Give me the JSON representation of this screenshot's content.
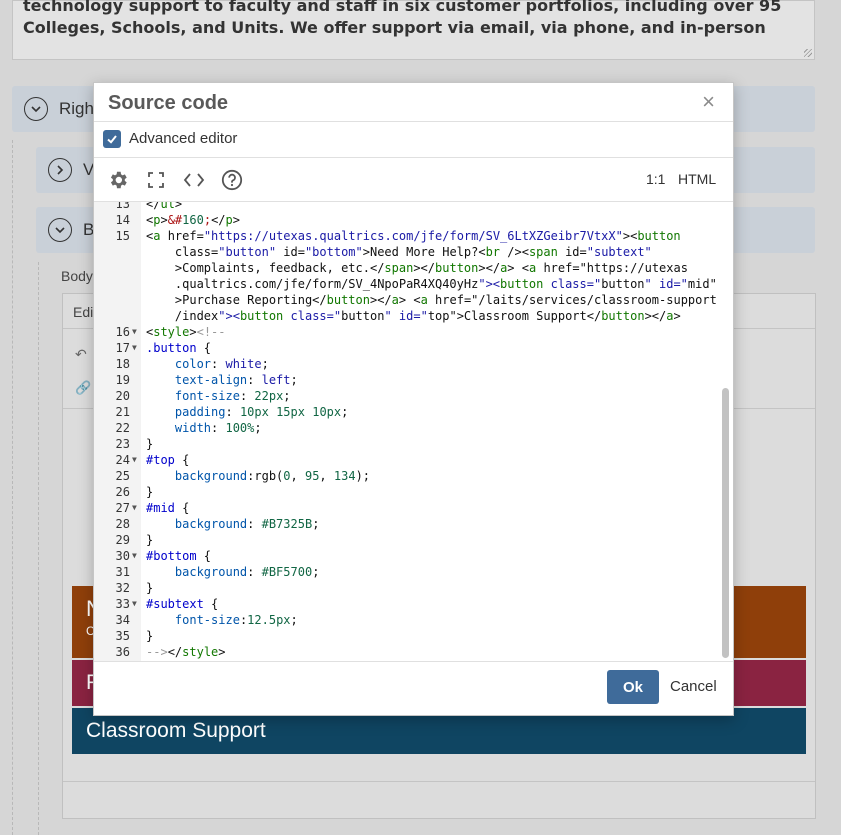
{
  "background": {
    "text_preview": "technology support to faculty and staff in six customer portfolios, including over 95",
    "text_preview2": "Colleges, Schools, and Units. We offer support via email, via phone, and in-person",
    "accordion1_label": "Righ",
    "accordion2_label": "V",
    "accordion3_label": "B",
    "body_label": "Body",
    "editor_label": "Edi",
    "strip1_letter": "N",
    "strip1_sub": "C",
    "strip2_letter": "P",
    "strip3_label": "Classroom Support",
    "colors": {
      "strip1": "#8f3f0a",
      "strip2": "#8a2341",
      "strip3": "#0f4562"
    }
  },
  "modal": {
    "title": "Source code",
    "close_glyph": "×",
    "advanced_editor_label": "Advanced editor",
    "advanced_editor_checked": true,
    "toolbar": {
      "ratio": "1:1",
      "mode": "HTML",
      "icons": [
        "gear-icon",
        "fullscreen-icon",
        "code-icon",
        "help-icon"
      ]
    },
    "code_lines": [
      {
        "n": "13",
        "fold": false
      },
      {
        "n": "14",
        "fold": false
      },
      {
        "n": "15",
        "fold": false
      },
      {
        "n": "",
        "fold": false
      },
      {
        "n": "",
        "fold": false
      },
      {
        "n": "",
        "fold": false
      },
      {
        "n": "",
        "fold": false
      },
      {
        "n": "",
        "fold": false
      },
      {
        "n": "16",
        "fold": true
      },
      {
        "n": "17",
        "fold": true
      },
      {
        "n": "18",
        "fold": false
      },
      {
        "n": "19",
        "fold": false
      },
      {
        "n": "20",
        "fold": false
      },
      {
        "n": "21",
        "fold": false
      },
      {
        "n": "22",
        "fold": false
      },
      {
        "n": "23",
        "fold": false
      },
      {
        "n": "24",
        "fold": true
      },
      {
        "n": "25",
        "fold": false
      },
      {
        "n": "26",
        "fold": false
      },
      {
        "n": "27",
        "fold": true
      },
      {
        "n": "28",
        "fold": false
      },
      {
        "n": "29",
        "fold": false
      },
      {
        "n": "30",
        "fold": true
      },
      {
        "n": "31",
        "fold": false
      },
      {
        "n": "32",
        "fold": false
      },
      {
        "n": "33",
        "fold": true
      },
      {
        "n": "34",
        "fold": false
      },
      {
        "n": "35",
        "fold": false
      },
      {
        "n": "36",
        "fold": false
      }
    ],
    "code_text": [
      "</ul>",
      "<p>&#160;</p>",
      "<a href=\"https://utexas.qualtrics.com/jfe/form/SV_6LtXZGeibr7VtxX\"><button",
      "    class=\"button\" id=\"bottom\">Need More Help?<br /><span id=\"subtext\"",
      "    >Complaints, feedback, etc.</span></button></a> <a href=\"https://utexas",
      "    .qualtrics.com/jfe/form/SV_4NpoPaR4XQ40yHz\"><button class=\"button\" id=\"mid\"",
      "    >Purchase Reporting</button></a> <a href=\"/laits/services/classroom-support",
      "    /index\"><button class=\"button\" id=\"top\">Classroom Support</button></a>",
      "<style><!--",
      ".button {",
      "    color: white;",
      "    text-align: left;",
      "    font-size: 22px;",
      "    padding: 10px 15px 10px;",
      "    width: 100%;",
      "}",
      "#top {",
      "    background:rgb(0, 95, 134);",
      "}",
      "#mid {",
      "    background: #B7325B;",
      "}",
      "#bottom {",
      "    background: #BF5700;",
      "}",
      "#subtext {",
      "    font-size:12.5px;",
      "}",
      "--></style>"
    ],
    "ok_label": "Ok",
    "cancel_label": "Cancel"
  }
}
